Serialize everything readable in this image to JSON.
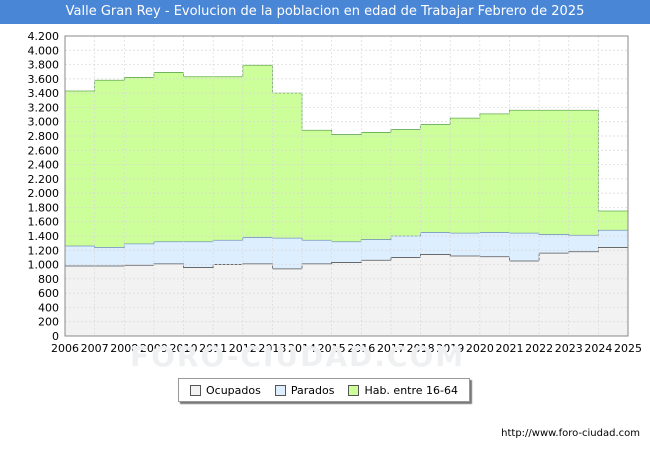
{
  "header": {
    "title": "Valle Gran Rey - Evolucion de la poblacion en edad de Trabajar Febrero de 2025"
  },
  "watermark": "FORO-CIUDAD.COM",
  "source": "http://www.foro-ciudad.com",
  "legend": [
    {
      "label": "Ocupados",
      "color": "#f2f2f2"
    },
    {
      "label": "Parados",
      "color": "#ddeeff"
    },
    {
      "label": "Hab. entre 16-64",
      "color": "#ccff99"
    }
  ],
  "chart_data": {
    "type": "area",
    "title": "Valle Gran Rey - Evolucion de la poblacion en edad de Trabajar Febrero de 2025",
    "xlabel": "",
    "ylabel": "",
    "xlim": [
      2006,
      2025
    ],
    "ylim": [
      0,
      4200
    ],
    "yticks": [
      0,
      200,
      400,
      600,
      800,
      1000,
      1200,
      1400,
      1600,
      1800,
      2000,
      2200,
      2400,
      2600,
      2800,
      3000,
      3200,
      3400,
      3600,
      3800,
      4000,
      4200
    ],
    "ytick_labels": [
      "0",
      "200",
      "400",
      "600",
      "800",
      "1.000",
      "1.200",
      "1.400",
      "1.600",
      "1.800",
      "2.000",
      "2.200",
      "2.400",
      "2.600",
      "2.800",
      "3.000",
      "3.200",
      "3.400",
      "3.600",
      "3.800",
      "4.000",
      "4.200"
    ],
    "xticks": [
      2006,
      2007,
      2008,
      2009,
      2010,
      2011,
      2012,
      2013,
      2014,
      2015,
      2016,
      2017,
      2018,
      2019,
      2020,
      2021,
      2022,
      2023,
      2024,
      2025
    ],
    "grid": true,
    "legend_position": "bottom",
    "series": [
      {
        "name": "Hab. entre 16-64",
        "color": "#ccff99",
        "x": [
          2006,
          2007,
          2008,
          2009,
          2010,
          2011,
          2012,
          2013,
          2014,
          2015,
          2016,
          2017,
          2018,
          2019,
          2020,
          2021,
          2022,
          2023,
          2024
        ],
        "values": [
          3430,
          3580,
          3620,
          3690,
          3630,
          3630,
          3790,
          3400,
          2880,
          2820,
          2850,
          2890,
          2960,
          3050,
          3110,
          3160,
          3160,
          3160,
          1750
        ]
      },
      {
        "name": "Parados",
        "color": "#ddeeff",
        "x": [
          2006,
          2007,
          2008,
          2009,
          2010,
          2011,
          2012,
          2013,
          2014,
          2015,
          2016,
          2017,
          2018,
          2019,
          2020,
          2021,
          2022,
          2023,
          2024,
          2025
        ],
        "values": [
          1260,
          1240,
          1290,
          1320,
          1320,
          1340,
          1380,
          1370,
          1340,
          1320,
          1350,
          1400,
          1450,
          1440,
          1450,
          1440,
          1420,
          1410,
          1480,
          1490
        ]
      },
      {
        "name": "Ocupados",
        "color": "#f2f2f2",
        "x": [
          2006,
          2007,
          2008,
          2009,
          2010,
          2011,
          2012,
          2013,
          2014,
          2015,
          2016,
          2017,
          2018,
          2019,
          2020,
          2021,
          2022,
          2023,
          2024,
          2025
        ],
        "values": [
          980,
          980,
          990,
          1010,
          960,
          1000,
          1010,
          940,
          1010,
          1030,
          1060,
          1100,
          1140,
          1120,
          1110,
          1050,
          1160,
          1180,
          1240,
          1250
        ]
      }
    ]
  }
}
